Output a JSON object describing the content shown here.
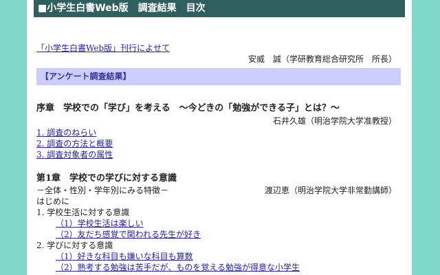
{
  "header": {
    "title": "■小学生白書Web版　調査結果　目次"
  },
  "intro": {
    "link_label": "「小学生白書Web版」刊行によせて",
    "author": "安威　誠（学研教育総合研究所　所長）"
  },
  "section": {
    "label": "【アンケート調査結果】"
  },
  "prologue": {
    "title": "序章　学校での「学び」を考える　～今どきの「勉強ができる子」とは？～",
    "author": "石井久雄（明治学院大学准教授）",
    "items": [
      "1. 調査のねらい",
      "2. 調査の方法と概要",
      "3. 調査対象者の属性"
    ]
  },
  "chapter1": {
    "title": "第1章　学校での学びに対する意識",
    "subtitle": "－全体・性別・学年別にみる特徴－",
    "author": "渡辺恵（明治学院大学非常勤講師）",
    "intro": "はじめに",
    "sections": [
      {
        "heading": "1. 学校生活に対する意識",
        "items": [
          "（1）学校生活は楽しい",
          "（2）友だち感覚で関われる先生が好き"
        ]
      },
      {
        "heading": "2. 学びに対する意識",
        "items": [
          "（1）好きな科目も嫌いな科目も算数",
          "（2）熟考する勉強は苦手だが、ものを覚える勉強が得意な小学生"
        ]
      }
    ]
  }
}
